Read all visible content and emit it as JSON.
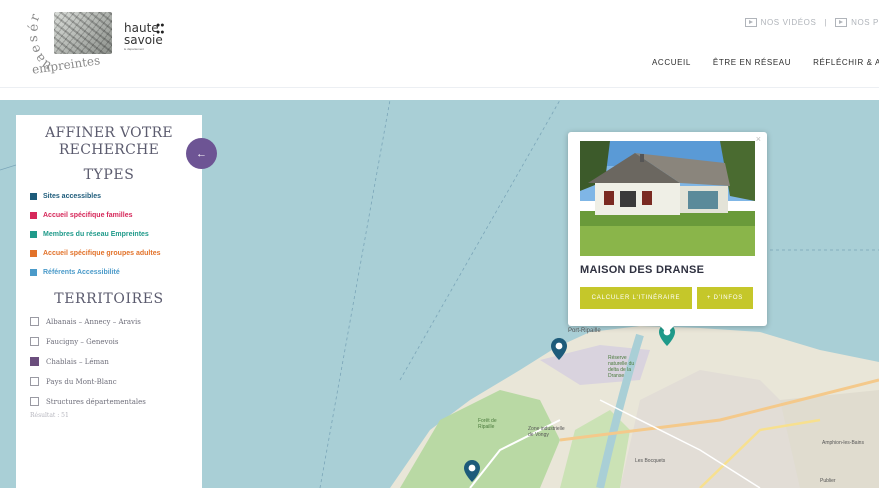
{
  "header": {
    "logo_reseau": {
      "word_top": "réseau",
      "word_bottom": "empreintes"
    },
    "logo_partner": {
      "line1": "haute",
      "line2": "savoie",
      "sub": "le département"
    },
    "top_links": [
      {
        "label": "NOS VIDÉOS",
        "icon": "video-icon"
      },
      {
        "label": "NOS P",
        "icon": "video-icon"
      }
    ],
    "nav": [
      "ACCUEIL",
      "ÊTRE EN RÉSEAU",
      "RÉFLÉCHIR & AGIR"
    ]
  },
  "panel": {
    "title": "AFFINER VOTRE RECHERCHE",
    "types_heading": "TYPES",
    "types": [
      {
        "label": "Sites accessibles",
        "color": "#1d5b7a"
      },
      {
        "label": "Accueil spécifique familles",
        "color": "#d6285a"
      },
      {
        "label": "Membres du réseau Empreintes",
        "color": "#1f9a8a"
      },
      {
        "label": "Accueil spécifique groupes adultes",
        "color": "#e2722a"
      },
      {
        "label": "Référents Accessibilité",
        "color": "#4a9ac9"
      }
    ],
    "territories_heading": "TERRITOIRES",
    "territories": [
      {
        "label": "Albanais – Annecy – Aravis",
        "checked": false
      },
      {
        "label": "Faucigny – Genevois",
        "checked": false
      },
      {
        "label": "Chablais – Léman",
        "checked": true
      },
      {
        "label": "Pays du Mont-Blanc",
        "checked": false
      },
      {
        "label": "Structures départementales",
        "checked": false
      }
    ],
    "result": "Résultat : 51",
    "collapse_icon": "chevron-left-icon"
  },
  "popup": {
    "title": "MAISON DES DRANSE",
    "close": "×",
    "btn_itinerary": "CALCULER L'ITINÉRAIRE",
    "btn_more": "+ D'INFOS",
    "accent": "#c5c72a"
  },
  "map": {
    "labels": [
      "Port-Ripaille",
      "Forêt de Ripaille",
      "Zone industrielle de Vongy",
      "Réserve naturelle du delta de la Dranse",
      "Les Bocquets",
      "Amphion-les-Bains",
      "Publier"
    ],
    "pins": [
      {
        "color": "#1d5b7a"
      },
      {
        "color": "#1f9a8a"
      },
      {
        "color": "#1d5b7a"
      }
    ]
  }
}
